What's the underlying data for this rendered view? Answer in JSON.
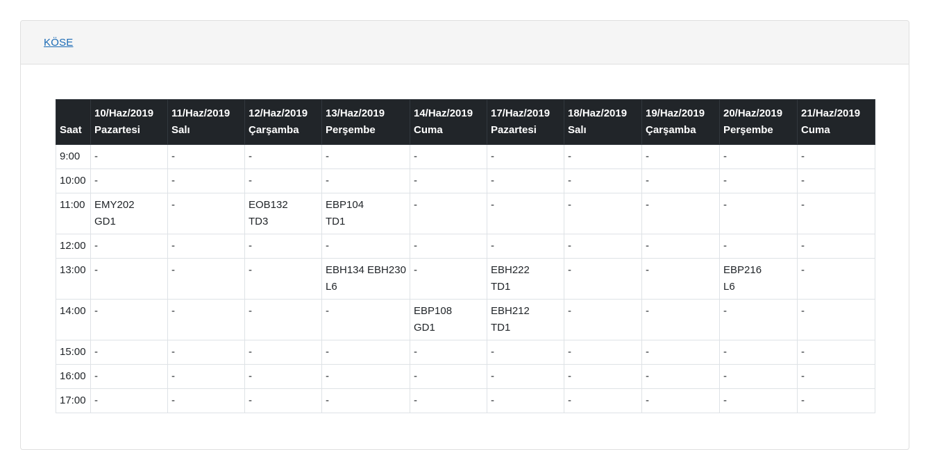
{
  "header": {
    "link_label": "KÖSE"
  },
  "table": {
    "hour_header": "Saat",
    "columns": [
      {
        "date": "10/Haz/2019",
        "day": "Pazartesi"
      },
      {
        "date": "11/Haz/2019",
        "day": "Salı"
      },
      {
        "date": "12/Haz/2019",
        "day": "Çarşamba"
      },
      {
        "date": "13/Haz/2019",
        "day": "Perşembe"
      },
      {
        "date": "14/Haz/2019",
        "day": "Cuma"
      },
      {
        "date": "17/Haz/2019",
        "day": "Pazartesi"
      },
      {
        "date": "18/Haz/2019",
        "day": "Salı"
      },
      {
        "date": "19/Haz/2019",
        "day": "Çarşamba"
      },
      {
        "date": "20/Haz/2019",
        "day": "Perşembe"
      },
      {
        "date": "21/Haz/2019",
        "day": "Cuma"
      }
    ],
    "rows": [
      {
        "time": "9:00",
        "cells": [
          [
            "-"
          ],
          [
            "-"
          ],
          [
            "-"
          ],
          [
            "-"
          ],
          [
            "-"
          ],
          [
            "-"
          ],
          [
            "-"
          ],
          [
            "-"
          ],
          [
            "-"
          ],
          [
            "-"
          ]
        ]
      },
      {
        "time": "10:00",
        "cells": [
          [
            "-"
          ],
          [
            "-"
          ],
          [
            "-"
          ],
          [
            "-"
          ],
          [
            "-"
          ],
          [
            "-"
          ],
          [
            "-"
          ],
          [
            "-"
          ],
          [
            "-"
          ],
          [
            "-"
          ]
        ]
      },
      {
        "time": "11:00",
        "cells": [
          [
            "EMY202",
            "GD1"
          ],
          [
            "-"
          ],
          [
            "EOB132",
            "TD3"
          ],
          [
            "EBP104",
            "TD1"
          ],
          [
            "-"
          ],
          [
            "-"
          ],
          [
            "-"
          ],
          [
            "-"
          ],
          [
            "-"
          ],
          [
            "-"
          ]
        ]
      },
      {
        "time": "12:00",
        "cells": [
          [
            "-"
          ],
          [
            "-"
          ],
          [
            "-"
          ],
          [
            "-"
          ],
          [
            "-"
          ],
          [
            "-"
          ],
          [
            "-"
          ],
          [
            "-"
          ],
          [
            "-"
          ],
          [
            "-"
          ]
        ]
      },
      {
        "time": "13:00",
        "cells": [
          [
            "-"
          ],
          [
            "-"
          ],
          [
            "-"
          ],
          [
            "EBH134 EBH230",
            "L6"
          ],
          [
            "-"
          ],
          [
            "EBH222",
            "TD1"
          ],
          [
            "-"
          ],
          [
            "-"
          ],
          [
            "EBP216",
            "L6"
          ],
          [
            "-"
          ]
        ]
      },
      {
        "time": "14:00",
        "cells": [
          [
            "-"
          ],
          [
            "-"
          ],
          [
            "-"
          ],
          [
            "-"
          ],
          [
            "EBP108",
            "GD1"
          ],
          [
            "EBH212",
            "TD1"
          ],
          [
            "-"
          ],
          [
            "-"
          ],
          [
            "-"
          ],
          [
            "-"
          ]
        ]
      },
      {
        "time": "15:00",
        "cells": [
          [
            "-"
          ],
          [
            "-"
          ],
          [
            "-"
          ],
          [
            "-"
          ],
          [
            "-"
          ],
          [
            "-"
          ],
          [
            "-"
          ],
          [
            "-"
          ],
          [
            "-"
          ],
          [
            "-"
          ]
        ]
      },
      {
        "time": "16:00",
        "cells": [
          [
            "-"
          ],
          [
            "-"
          ],
          [
            "-"
          ],
          [
            "-"
          ],
          [
            "-"
          ],
          [
            "-"
          ],
          [
            "-"
          ],
          [
            "-"
          ],
          [
            "-"
          ],
          [
            "-"
          ]
        ]
      },
      {
        "time": "17:00",
        "cells": [
          [
            "-"
          ],
          [
            "-"
          ],
          [
            "-"
          ],
          [
            "-"
          ],
          [
            "-"
          ],
          [
            "-"
          ],
          [
            "-"
          ],
          [
            "-"
          ],
          [
            "-"
          ],
          [
            "-"
          ]
        ]
      }
    ]
  }
}
